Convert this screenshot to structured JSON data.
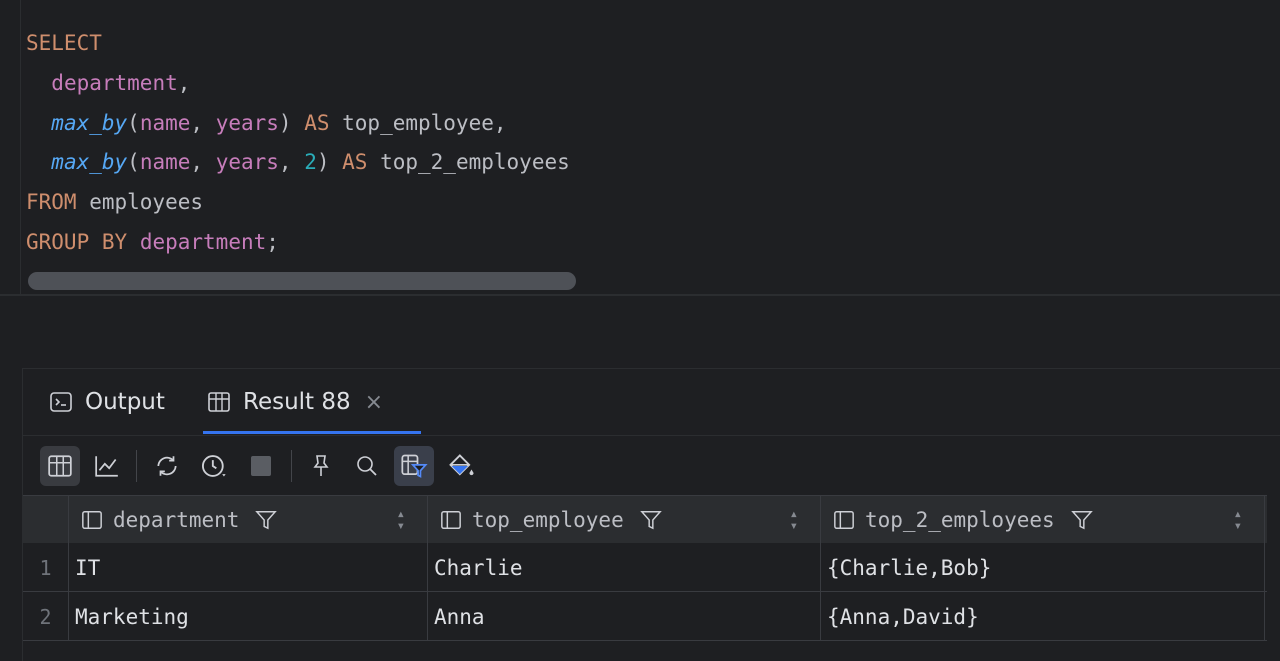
{
  "editor": {
    "lines": [
      [
        {
          "t": "SELECT",
          "c": "kw"
        }
      ],
      [
        {
          "t": "  ",
          "c": "plain"
        },
        {
          "t": "department",
          "c": "col"
        },
        {
          "t": ",",
          "c": "plain"
        }
      ],
      [
        {
          "t": "  ",
          "c": "plain"
        },
        {
          "t": "max_by",
          "c": "fn"
        },
        {
          "t": "(",
          "c": "plain"
        },
        {
          "t": "name",
          "c": "col"
        },
        {
          "t": ", ",
          "c": "plain"
        },
        {
          "t": "years",
          "c": "col"
        },
        {
          "t": ") ",
          "c": "plain"
        },
        {
          "t": "AS",
          "c": "kw"
        },
        {
          "t": " top_employee,",
          "c": "plain"
        }
      ],
      [
        {
          "t": "  ",
          "c": "plain"
        },
        {
          "t": "max_by",
          "c": "fn"
        },
        {
          "t": "(",
          "c": "plain"
        },
        {
          "t": "name",
          "c": "col"
        },
        {
          "t": ", ",
          "c": "plain"
        },
        {
          "t": "years",
          "c": "col"
        },
        {
          "t": ", ",
          "c": "plain"
        },
        {
          "t": "2",
          "c": "num"
        },
        {
          "t": ") ",
          "c": "plain"
        },
        {
          "t": "AS",
          "c": "kw"
        },
        {
          "t": " top_2_employees",
          "c": "plain"
        }
      ],
      [
        {
          "t": "FROM",
          "c": "kw"
        },
        {
          "t": " employees",
          "c": "plain"
        }
      ],
      [
        {
          "t": "GROUP BY",
          "c": "kw"
        },
        {
          "t": " ",
          "c": "plain"
        },
        {
          "t": "department",
          "c": "col"
        },
        {
          "t": ";",
          "c": "plain"
        }
      ]
    ]
  },
  "tabs": {
    "output_label": "Output",
    "result_label": "Result 88",
    "close_glyph": "×"
  },
  "toolbar": {
    "icons": [
      "table-view-icon",
      "chart-view-icon",
      "refresh-icon",
      "history-icon",
      "stop-icon",
      "pin-icon",
      "search-icon",
      "filter-icon",
      "paint-bucket-icon"
    ]
  },
  "grid": {
    "columns": [
      "department",
      "top_employee",
      "top_2_employees"
    ],
    "rows": [
      {
        "num": "1",
        "cells": [
          "IT",
          "Charlie",
          "{Charlie,Bob}"
        ]
      },
      {
        "num": "2",
        "cells": [
          "Marketing",
          "Anna",
          "{Anna,David}"
        ]
      }
    ]
  },
  "colors": {
    "accent": "#3574f0",
    "keyword": "#cf8e6d",
    "column": "#c77dbb",
    "function": "#56a8f5",
    "number": "#2aacb8"
  }
}
